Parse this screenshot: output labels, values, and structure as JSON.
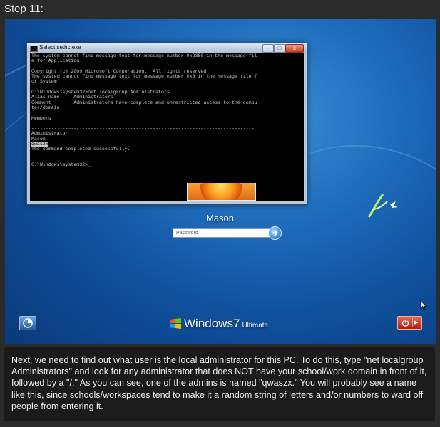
{
  "step_label": "Step 11:",
  "cmd_window": {
    "title": "Select sethc.exe",
    "buttons": {
      "minimize": "–",
      "maximize": "□",
      "close": "x"
    },
    "lines": [
      "The system cannot find message text for message number 0x2350 in the message fil",
      "e for Application.",
      "",
      "Copyright (c) 2009 Microsoft Corporation.  All rights reserved.",
      "The system cannot find message text for message number 0x8 in the message file f",
      "or System.",
      "",
      "C:\\Windows\\system32>net localgroup Administrators",
      "Alias name     Administrators",
      "Comment        Administrators have complete and unrestricted access to the compu",
      "ter/domain",
      "",
      "Members",
      "",
      "-------------------------------------------------------------------------------",
      "Administrator",
      "Mason",
      "qwaszx",
      "The command completed successfully.",
      "",
      "",
      "C:\\Windows\\system32>_"
    ],
    "selected_line_index": 17
  },
  "login": {
    "username": "Mason",
    "password_placeholder": "Password"
  },
  "branding": {
    "windows": "Windows",
    "version": "7",
    "edition": "Ultimate"
  },
  "icons": {
    "ease_of_access": "ease-of-access-icon",
    "submit": "arrow-right-icon",
    "power": "power-icon",
    "windows_flag": "windows-flag-icon",
    "cursor": "mouse-cursor-icon"
  },
  "colors": {
    "screen_blue": "#1f6dbd",
    "power_red": "#b31c0e",
    "description_bg": "#1b1b1b"
  },
  "description": "Next, we need to find out what user is the local administrator for this PC. To do this, type \"net localgroup Administrators\" and look for any administrator that does NOT have your school/work domain in front of it, followed by a \"/.\" As you can see, one of the admins is named \"qwaszx.\" You will probably see a name like this, since schools/workspaces tend to make it a random string of letters and/or numbers to ward off people from entering it."
}
